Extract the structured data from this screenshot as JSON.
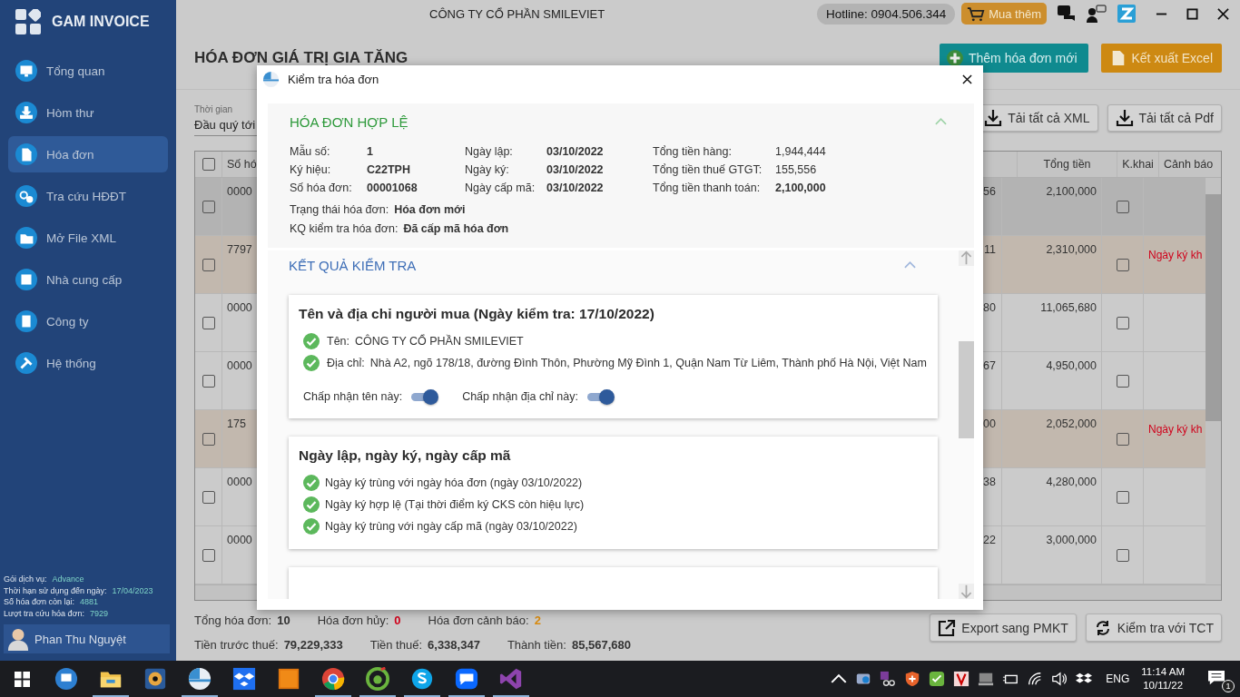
{
  "app": {
    "name": "GAM INVOICE"
  },
  "sidebar": {
    "items": [
      {
        "label": "Tổng quan",
        "selected": false
      },
      {
        "label": "Hòm thư",
        "selected": false
      },
      {
        "label": "Hóa đơn",
        "selected": true
      },
      {
        "label": "Tra cứu HĐĐT",
        "selected": false
      },
      {
        "label": "Mở File XML",
        "selected": false
      },
      {
        "label": "Nhà cung cấp",
        "selected": false
      },
      {
        "label": "Công ty",
        "selected": false
      },
      {
        "label": "Hệ thống",
        "selected": false
      }
    ],
    "service_info": [
      {
        "label": "Gói dịch vụ:",
        "value": "Advance"
      },
      {
        "label": "Thời hạn sử dụng đến ngày:",
        "value": "17/04/2023"
      },
      {
        "label": "Số hóa đơn còn lại:",
        "value": "4881"
      },
      {
        "label": "Lượt tra cứu hóa đơn:",
        "value": "7929"
      }
    ],
    "user": {
      "name": "Phan Thu Nguyệt"
    }
  },
  "top_bar": {
    "company": "CÔNG TY CỔ PHẦN SMILEVIET",
    "hotline": "Hotline: 0904.506.344",
    "buy_button": "Mua thêm"
  },
  "page": {
    "title": "HÓA ĐƠN GIÁ TRỊ GIA TĂNG",
    "add_button": "Thêm hóa đơn mới",
    "excel_button": "Kết xuất Excel",
    "time_filter": {
      "label": "Thời gian",
      "value": "Đầu quý tới"
    },
    "xml_button": "Tải tất cả XML",
    "pdf_button": "Tải tất cả Pdf"
  },
  "table": {
    "header_checked": false,
    "columns": [
      "Số hó",
      "Tổng tiền",
      "K.khai",
      "Cảnh báo"
    ],
    "rows": [
      {
        "selected": true,
        "flagged": false,
        "checked": false,
        "column_1": "0000",
        "column_3": "56",
        "total": "2,100,000",
        "declared": false
      },
      {
        "selected": false,
        "flagged": true,
        "checked": false,
        "column_1": "7797",
        "column_3": "11",
        "total": "2,310,000",
        "declared": false,
        "warning": "Ngày ký kh"
      },
      {
        "selected": false,
        "flagged": false,
        "checked": false,
        "column_1": "0000",
        "column_3": "80",
        "total": "11,065,680",
        "declared": false
      },
      {
        "selected": false,
        "flagged": false,
        "checked": false,
        "column_1": "0000",
        "column_3": "67",
        "total": "4,950,000",
        "declared": false
      },
      {
        "selected": false,
        "flagged": true,
        "checked": false,
        "column_1": "175",
        "column_3": "00",
        "total": "2,052,000",
        "declared": false,
        "warning": "Ngày ký kh"
      },
      {
        "selected": false,
        "flagged": false,
        "checked": false,
        "column_1": "0000",
        "column_3": "38",
        "total": "4,280,000",
        "declared": false
      },
      {
        "selected": false,
        "flagged": false,
        "checked": false,
        "column_1": "0000",
        "column_3": "22",
        "total": "3,000,000",
        "declared": false
      }
    ]
  },
  "summary": {
    "stats": [
      {
        "label": "Tổng hóa đơn:",
        "value": "10",
        "kind": "total"
      },
      {
        "label": "Hóa đơn hủy:",
        "value": "0",
        "kind": "cancelled"
      },
      {
        "label": "Hóa đơn cảnh báo:",
        "value": "2",
        "kind": "warning"
      }
    ],
    "amounts": [
      {
        "label": "Tiền trước thuế:",
        "value": "79,229,333"
      },
      {
        "label": "Tiền thuế:",
        "value": "6,338,347"
      },
      {
        "label": "Thành tiền:",
        "value": "85,567,680"
      }
    ],
    "buttons": [
      {
        "kind": "export",
        "label": "Export sang PMKT"
      },
      {
        "kind": "sync",
        "label": "Kiểm tra với TCT"
      }
    ]
  },
  "dialog": {
    "title": "Kiểm tra hóa đơn",
    "valid_section": {
      "title": "HÓA ĐƠN HỢP LỆ",
      "expanded": true,
      "fields": [
        {
          "label": "Mẫu số:",
          "value": "1",
          "emphasis": true
        },
        {
          "label": "Ngày lập:",
          "value": "03/10/2022",
          "emphasis": true
        },
        {
          "label": "Tổng tiền hàng:",
          "value": "1,944,444",
          "emphasis": false
        },
        {
          "label": "Ký hiệu:",
          "value": "C22TPH",
          "emphasis": true
        },
        {
          "label": "Ngày ký:",
          "value": "03/10/2022",
          "emphasis": true
        },
        {
          "label": "Tổng tiền thuế GTGT:",
          "value": "155,556",
          "emphasis": false
        },
        {
          "label": "Số hóa đơn:",
          "value": "00001068",
          "emphasis": true
        },
        {
          "label": "Ngày cấp mã:",
          "value": "03/10/2022",
          "emphasis": true
        },
        {
          "label": "Tổng tiền thanh toán:",
          "value": "2,100,000",
          "emphasis": true
        }
      ],
      "status": [
        {
          "label": "Trạng thái hóa đơn:",
          "value": "Hóa đơn mới"
        },
        {
          "label": "KQ kiểm tra hóa đơn:",
          "value": "Đã cấp mã hóa đơn"
        }
      ]
    },
    "check_section": {
      "title": "KẾT QUẢ KIỂM TRA",
      "expanded": true,
      "cards": [
        {
          "title": "Tên và địa chỉ người mua (Ngày kiểm tra: 17/10/2022)",
          "checks": [
            {
              "passed": true,
              "label": "Tên:",
              "value": "CÔNG TY CỔ PHẦN SMILEVIET"
            },
            {
              "passed": true,
              "label": "Địa chỉ:",
              "value": "Nhà A2, ngõ 178/18, đường Đình Thôn, Phường Mỹ Đình 1, Quận Nam Từ Liêm, Thành phố Hà Nội, Việt Nam"
            }
          ],
          "toggles": [
            {
              "label": "Chấp nhận tên này:",
              "on": true
            },
            {
              "label": "Chấp nhận địa chỉ này:",
              "on": true
            }
          ]
        },
        {
          "title": "Ngày lập, ngày ký, ngày cấp mã",
          "checks": [
            {
              "passed": true,
              "value": "Ngày ký trùng với ngày hóa đơn (ngày 03/10/2022)"
            },
            {
              "passed": true,
              "value": "Ngày ký hợp lệ (Tại thời điểm ký CKS còn hiệu lực)"
            },
            {
              "passed": true,
              "value": "Ngày ký trùng với ngày cấp mã (ngày 03/10/2022)"
            }
          ]
        },
        {
          "kind": "partial"
        }
      ]
    }
  },
  "taskbar": {
    "apps": [
      {
        "kind": "remote",
        "running": false
      },
      {
        "kind": "explorer",
        "running": true
      },
      {
        "kind": "media",
        "running": false
      },
      {
        "kind": "gam",
        "running": true
      },
      {
        "kind": "dropbox",
        "running": false
      },
      {
        "kind": "illustrator",
        "running": false
      },
      {
        "kind": "chrome",
        "running": true
      },
      {
        "kind": "coccoc",
        "running": true
      },
      {
        "kind": "skype",
        "running": true
      },
      {
        "kind": "zalo",
        "running": true
      },
      {
        "kind": "studio",
        "running": true
      }
    ],
    "tray": {
      "language": "ENG",
      "time": "11:14 AM",
      "date": "10/11/22",
      "notifications": "1"
    }
  }
}
